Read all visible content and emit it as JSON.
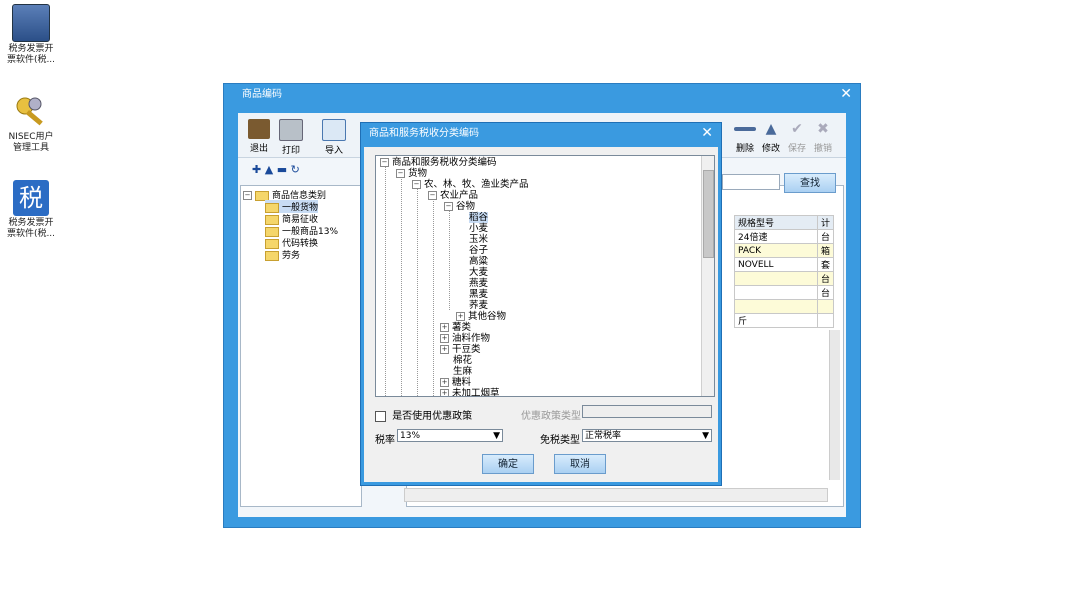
{
  "desktop": {
    "icons": [
      {
        "label": "税务发票开\n票软件(税..."
      },
      {
        "label": "NISEC用户\n管理工具"
      },
      {
        "label": "税务发票开\n票软件(税..."
      }
    ]
  },
  "main_window": {
    "title": "商品编码",
    "toolbar": {
      "exit": "退出",
      "print": "打印",
      "import": "导入",
      "delete": "删除",
      "modify": "修改",
      "save": "保存",
      "cancel": "撤销"
    },
    "search_button": "查找",
    "category_tree": {
      "root": "商品信息类别",
      "items": [
        "一般货物",
        "简易征收",
        "一般商品13%",
        "代码转换",
        "劳务"
      ]
    },
    "grid": {
      "header": [
        "规格型号",
        "计"
      ],
      "rows": [
        [
          "24倍速",
          "台"
        ],
        [
          "PACK",
          "箱"
        ],
        [
          "NOVELL",
          "套"
        ],
        [
          "",
          "台"
        ],
        [
          "",
          "台"
        ],
        [
          "",
          ""
        ],
        [
          "斤",
          ""
        ]
      ]
    }
  },
  "dialog": {
    "title": "商品和服务税收分类编码",
    "tree": {
      "root": "商品和服务税收分类编码",
      "goods": "货物",
      "agri": "农、林、牧、渔业类产品",
      "farm": "农业产品",
      "grain": "谷物",
      "grain_items": [
        "稻谷",
        "小麦",
        "玉米",
        "谷子",
        "高粱",
        "大麦",
        "燕麦",
        "黑麦",
        "荞麦"
      ],
      "other_grain": "其他谷物",
      "after": [
        "薯类",
        "油料作物",
        "干豆类",
        "棉花",
        "生麻",
        "糖料",
        "未加工烟草"
      ]
    },
    "use_preferential_label": "是否使用优惠政策",
    "preferential_type_label": "优惠政策类型",
    "tax_rate_label": "税率",
    "tax_rate_value": "13%",
    "exempt_type_label": "免税类型",
    "exempt_type_value": "正常税率",
    "ok_button": "确定",
    "cancel_button": "取消"
  }
}
